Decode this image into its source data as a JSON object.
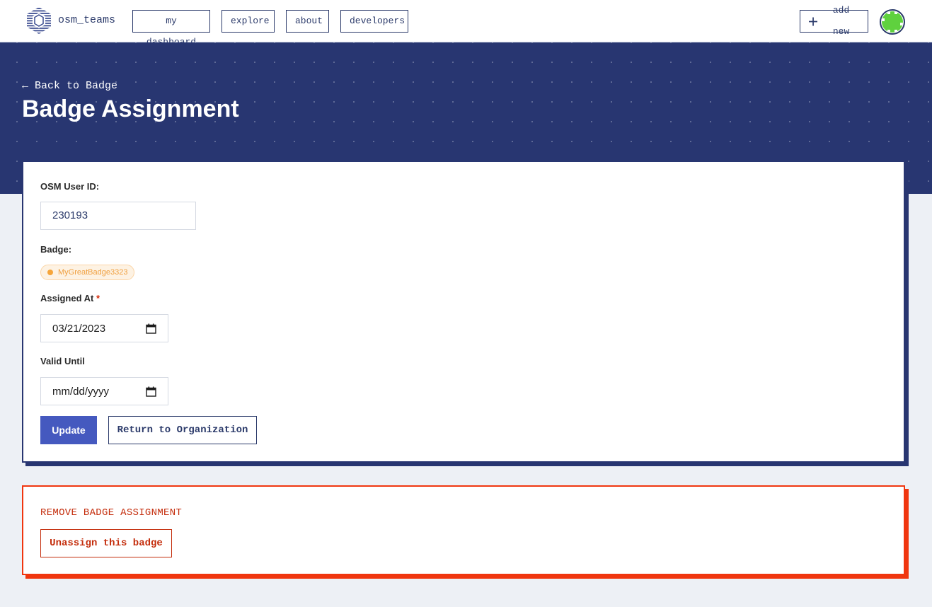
{
  "nav": {
    "brand": "osm_teams",
    "links": [
      "my dashboard",
      "explore",
      "about",
      "developers"
    ],
    "add_new": "add new"
  },
  "colors": {
    "primary": "#283671",
    "button": "#4559bf",
    "danger": "#f0360f",
    "badge": "#f6a53a"
  },
  "hero": {
    "back_link": "← Back to Badge",
    "title": "Badge Assignment"
  },
  "form": {
    "osm_user_id_label": "OSM User ID:",
    "osm_user_id_value": "230193",
    "badge_label": "Badge:",
    "badge_name": "MyGreatBadge3323",
    "assigned_at_label": "Assigned At",
    "required_mark": "*",
    "assigned_at_value": "03/21/2023",
    "valid_until_label": "Valid Until",
    "valid_until_placeholder": "mm/dd/yyyy",
    "update_button": "Update",
    "return_button": "Return to Organization"
  },
  "danger_zone": {
    "title": "REMOVE BADGE ASSIGNMENT",
    "unassign_button": "Unassign this badge"
  }
}
